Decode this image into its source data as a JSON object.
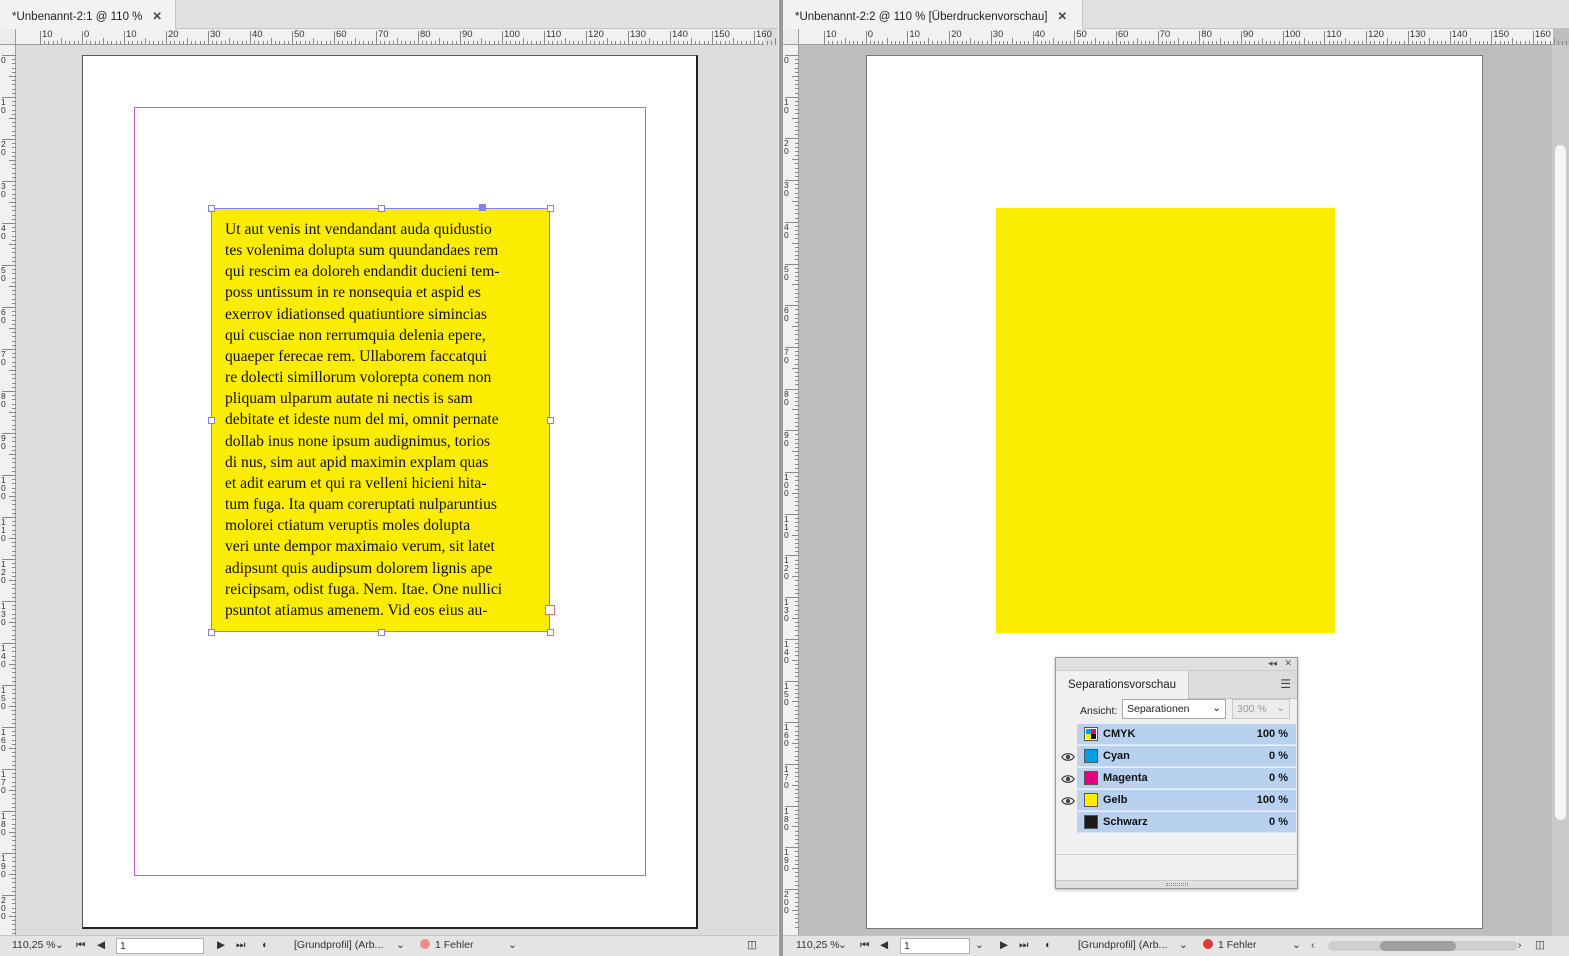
{
  "left_window": {
    "tab_title": "*Unbenannt-2:1 @ 110 %",
    "ruler_h_labels": [
      "10",
      "0",
      "10",
      "20",
      "30",
      "40",
      "50",
      "60",
      "70",
      "80",
      "90",
      "100",
      "110",
      "120",
      "130",
      "140",
      "150",
      "160"
    ],
    "ruler_v_labels": [
      "0",
      "1 0",
      "2 0",
      "3 0",
      "4 0",
      "5 0",
      "6 0",
      "7 0",
      "8 0",
      "9 0",
      "1 0 0",
      "1 1 0",
      "1 2 0",
      "1 3 0",
      "1 4 0",
      "1 5 0",
      "1 6 0",
      "1 7 0",
      "1 8 0",
      "1 9 0",
      "2 0 0"
    ],
    "text_lines": [
      "Ut aut venis int vendandant auda quidustio",
      "tes volenima dolupta sum quundandaes rem",
      "qui rescim ea doloreh endandit ducieni tem-",
      "poss untissum in re nonsequia et aspid es",
      "exerrov idiationsed quatiuntiore simincias",
      "qui cusciae non rerrumquia delenia epere,",
      "quaeper ferecae rem. Ullaborem faccatqui",
      "re dolecti simillorum volorepta conem non",
      "pliquam ulparum autate ni nectis is sam",
      "debitate et ideste num del mi, omnit pernate",
      "dollab inus none ipsum audignimus, torios",
      "di nus, sim aut apid maximin explam quas",
      "et adit earum et qui ra velleni hicieni hita-",
      "tum fuga. Ita quam coreruptati nulparuntius",
      "molorei ctiatum veruptis moles dolupta",
      "veri unte dempor maximaio verum, sit latet",
      "adipsunt quis audipsum dolorem lignis ape",
      "reicipsam, odist fuga. Nem. Itae. One nullici",
      "psuntot atiamus amenem. Vid eos eius au-"
    ],
    "status": {
      "zoom": "110,25 %",
      "page": "1",
      "profile": "[Grundprofil] (Arb...",
      "errors": "1 Fehler"
    }
  },
  "right_window": {
    "tab_title": "*Unbenannt-2:2 @ 110 % [Überdruckenvorschau]",
    "ruler_h_labels": [
      "10",
      "0",
      "10",
      "20",
      "30",
      "40",
      "50",
      "60",
      "70",
      "80",
      "90",
      "100",
      "110",
      "120",
      "130",
      "140",
      "150",
      "160"
    ],
    "ruler_v_labels": [
      "0",
      "1 0",
      "2 0",
      "3 0",
      "4 0",
      "5 0",
      "6 0",
      "7 0",
      "8 0",
      "9 0",
      "1 0 0",
      "1 1 0",
      "1 2 0",
      "1 3 0",
      "1 4 0",
      "1 5 0",
      "1 6 0",
      "1 7 0",
      "1 8 0",
      "1 9 0",
      "2 0 0"
    ],
    "status": {
      "zoom": "110,25 %",
      "page": "1",
      "profile": "[Grundprofil] (Arb...",
      "errors": "1 Fehler"
    }
  },
  "separations_panel": {
    "title": "Separationsvorschau",
    "view_label": "Ansicht:",
    "view_value": "Separationen",
    "ink_limit": "300 %",
    "rows": [
      {
        "name": "CMYK",
        "percent": "100 %",
        "color": "#000000",
        "icon": "cmyk-composite-icon",
        "eye": false
      },
      {
        "name": "Cyan",
        "percent": "0 %",
        "color": "#009fe3",
        "icon": "cyan-swatch-icon",
        "eye": true
      },
      {
        "name": "Magenta",
        "percent": "0 %",
        "color": "#e5007d",
        "icon": "magenta-swatch-icon",
        "eye": true
      },
      {
        "name": "Gelb",
        "percent": "100 %",
        "color": "#ffed00",
        "icon": "yellow-swatch-icon",
        "eye": true
      },
      {
        "name": "Schwarz",
        "percent": "0 %",
        "color": "#1a1a1a",
        "icon": "black-swatch-icon",
        "eye": false
      }
    ]
  },
  "colors": {
    "frame_yellow": "#fcec00",
    "margin_guide": "#c85bd4",
    "selection": "#8a7fe0",
    "error_red": "#e03a3a",
    "row_highlight": "#b7d1ef"
  }
}
